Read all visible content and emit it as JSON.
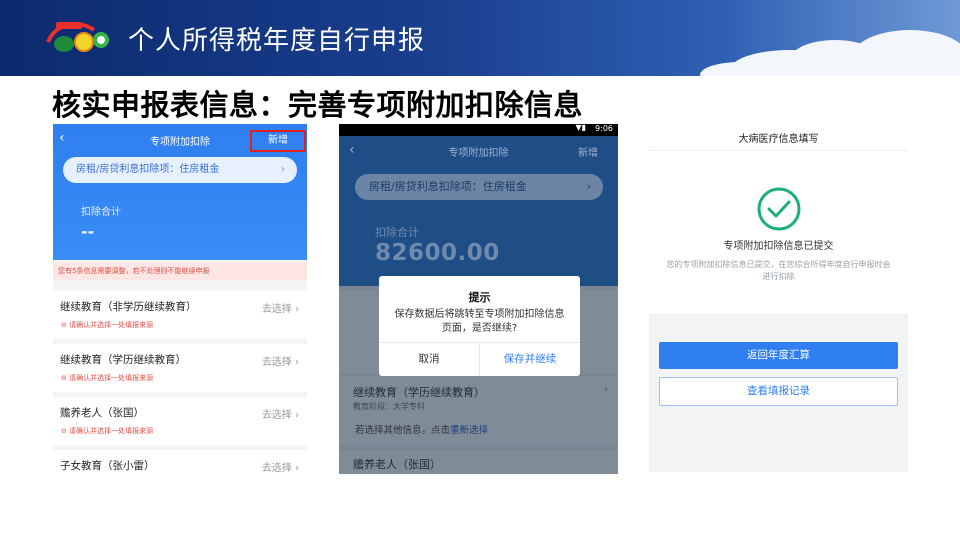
{
  "banner": {
    "title": "个人所得税年度自行申报"
  },
  "heading": "核实申报表信息：完善专项附加扣除信息",
  "screen1": {
    "nav_title": "专项附加扣除",
    "back": "‹",
    "add": "新增",
    "pill": "房租/房贷利息扣除项：住房租金",
    "sum_label": "扣除合计",
    "sum_value": "--",
    "warning": "您有5条信息需要调整，若不处理则不能继续申报",
    "rows": [
      {
        "title": "继续教育（非学历继续教育）",
        "action": "去选择",
        "sub": "请确认并选择一处填报来源"
      },
      {
        "title": "继续教育（学历继续教育）",
        "action": "去选择",
        "sub": "请确认并选择一处填报来源"
      },
      {
        "title": "赡养老人（张国）",
        "action": "去选择",
        "sub": "请确认并选择一处填报来源"
      },
      {
        "title": "子女教育（张小雷）",
        "action": "去选择",
        "sub": ""
      }
    ]
  },
  "screen2": {
    "status_time": "9:06",
    "nav_title": "专项附加扣除",
    "back": "‹",
    "add": "新增",
    "pill": "房租/房贷利息扣除项：住房租金",
    "sum_label": "扣除合计",
    "sum_value": "82600.00",
    "rows": [
      {
        "title": "继续教育（学历继续教育）",
        "sub": "教育阶段：大学专科",
        "link_prefix": "若选择其他信息，点击",
        "link": "重新选择"
      },
      {
        "title": "赡养老人（张国）"
      }
    ],
    "dialog": {
      "title": "提示",
      "message": "保存数据后将跳转至专项附加扣除信息页面，是否继续?",
      "cancel": "取消",
      "confirm": "保存并继续"
    }
  },
  "screen3": {
    "title": "大病医疗信息填写",
    "done": "专项附加扣除信息已提交",
    "desc": "您的专项附加扣除信息已提交，在您综合所得年度自行申报时会进行扣除",
    "btn_primary": "返回年度汇算",
    "btn_secondary": "查看填报记录"
  },
  "colors": {
    "accent": "#2f7ff0",
    "alert": "#e0201c",
    "success": "#1bb07a"
  }
}
